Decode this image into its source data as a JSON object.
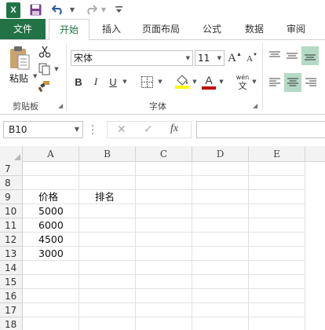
{
  "quick_access": {
    "app_icon": "excel-logo-icon",
    "app_letter": "X",
    "icons": [
      "save-icon",
      "undo-icon",
      "redo-icon",
      "customize-icon"
    ]
  },
  "tabs": [
    "文件",
    "开始",
    "插入",
    "页面布局",
    "公式",
    "数据",
    "审阅"
  ],
  "ribbon": {
    "clipboard": {
      "paste_label": "粘贴",
      "group_label": "剪贴板"
    },
    "font": {
      "font_name": "宋体",
      "font_size": "11",
      "grow_label": "A",
      "shrink_label": "A",
      "bold": "B",
      "italic": "I",
      "underline": "U",
      "font_color_letter": "A",
      "phonetic_top": "wén",
      "phonetic_bottom": "文",
      "group_label": "字体"
    },
    "colors": {
      "accent": "#217346",
      "highlight": "#ffff00",
      "font_color": "#c00000",
      "align_active": "#b5d9c5"
    }
  },
  "formula_bar": {
    "name_box": "B10",
    "fx": "fx",
    "cancel": "✕",
    "enter": "✓"
  },
  "grid": {
    "columns": [
      "A",
      "B",
      "C",
      "D",
      "E"
    ],
    "rows": [
      "7",
      "8",
      "9",
      "10",
      "11",
      "12",
      "13",
      "14",
      "15",
      "16",
      "17",
      "18"
    ],
    "cells": {
      "A9": "价格",
      "B9": "排名",
      "A10": "5000",
      "A11": "6000",
      "A12": "4500",
      "A13": "3000"
    }
  }
}
